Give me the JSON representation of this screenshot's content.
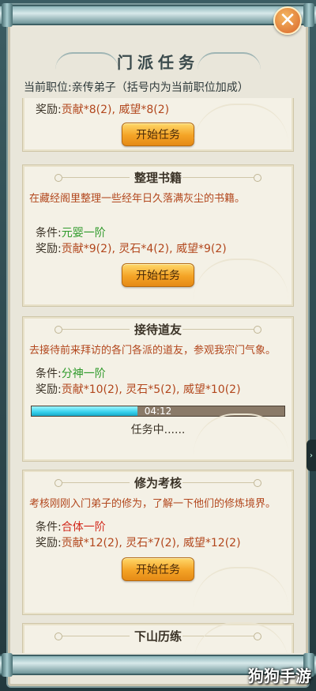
{
  "header": {
    "title": "门派任务",
    "close_glyph": "✕",
    "position_line": "当前职位:亲传弟子（括号内为当前职位加成）"
  },
  "labels": {
    "condition": "条件:",
    "reward": "奖励:",
    "start_button": "开始任务",
    "in_progress": "任务中......"
  },
  "tasks": [
    {
      "reward": "贡献*8(2), 威望*8(2)"
    },
    {
      "title": "整理书籍",
      "desc": "在藏经阁里整理一些经年日久落满灰尘的书籍。",
      "condition": "元婴一阶",
      "condition_color": "#2f9a2b",
      "reward": "贡献*9(2), 灵石*4(2), 威望*9(2)"
    },
    {
      "title": "接待道友",
      "desc": "去接待前来拜访的各门各派的道友，参观我宗门气象。",
      "condition": "分神一阶",
      "condition_color": "#2f9a2b",
      "reward": "贡献*10(2), 灵石*5(2), 威望*10(2)",
      "timer": "04:12",
      "progress": 0.42
    },
    {
      "title": "修为考核",
      "desc": "考核刚刚入门弟子的修为，了解一下他们的修炼境界。",
      "condition": "合体一阶",
      "condition_color": "#d22a1d",
      "reward": "贡献*12(2), 灵石*7(2), 威望*12(2)"
    },
    {
      "title": "下山历练"
    }
  ],
  "watermark": "狗狗手游",
  "colors": {
    "accent_orange": "#f4a326",
    "reward_text": "#b2471d",
    "progress_cyan": "#36d0ec"
  },
  "icons": {
    "close": "close-icon",
    "side": "chevron-right-icon"
  }
}
